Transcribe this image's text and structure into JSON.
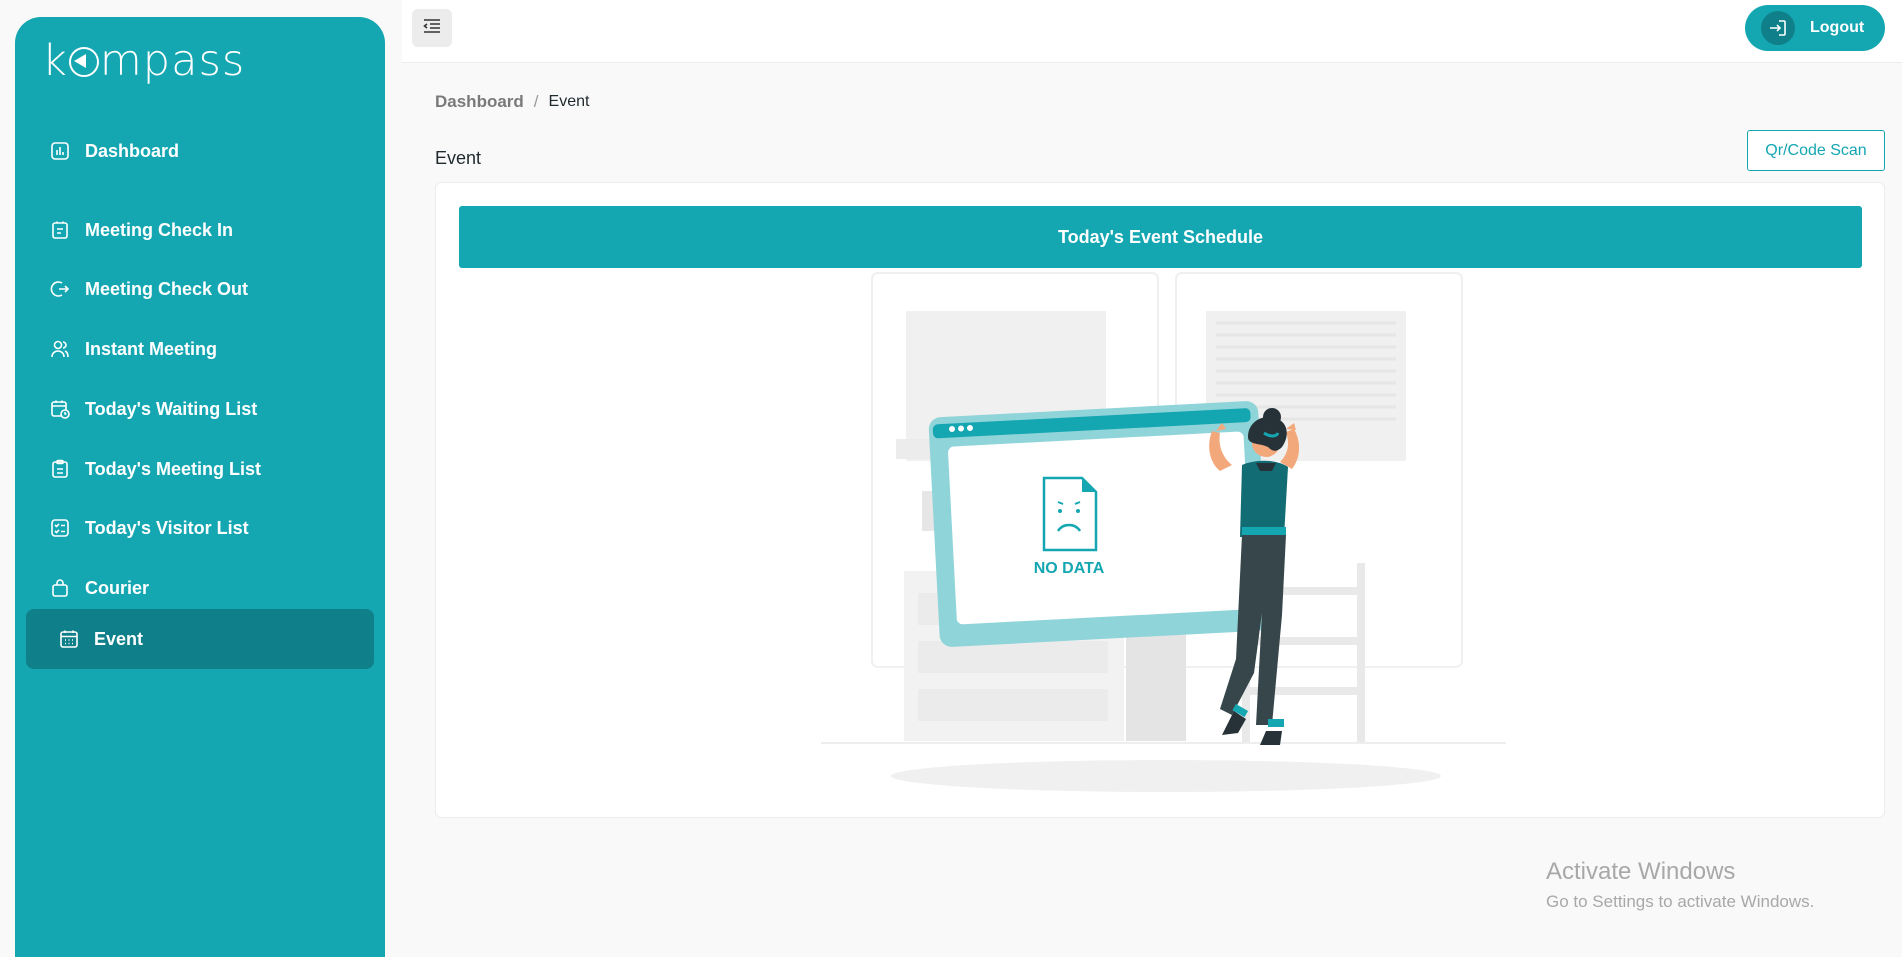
{
  "app": {
    "logo_text": "kompass"
  },
  "sidebar": {
    "items": [
      {
        "label": "Dashboard",
        "icon": "chart-icon"
      },
      {
        "label": "Meeting Check In",
        "icon": "clipboard-icon"
      },
      {
        "label": "Meeting Check Out",
        "icon": "exit-arrow-icon"
      },
      {
        "label": "Instant Meeting",
        "icon": "users-icon"
      },
      {
        "label": "Today's Waiting List",
        "icon": "calendar-clock-icon"
      },
      {
        "label": "Today's Meeting List",
        "icon": "clipboard-list-icon"
      },
      {
        "label": "Today's Visitor List",
        "icon": "checklist-icon"
      },
      {
        "label": "Courier",
        "icon": "bag-icon"
      },
      {
        "label": "Event",
        "icon": "calendar-icon",
        "active": true
      }
    ]
  },
  "topbar": {
    "logout_label": "Logout"
  },
  "breadcrumb": {
    "parent": "Dashboard",
    "separator": "/",
    "current": "Event"
  },
  "page": {
    "title": "Event",
    "qr_button": "Qr/Code Scan",
    "banner": "Today's Event Schedule",
    "empty_state": "NO DATA"
  },
  "watermark": {
    "title": "Activate Windows",
    "subtitle": "Go to Settings to activate Windows."
  },
  "colors": {
    "primary": "#14a6b1",
    "primary_dark": "#0f8089",
    "background": "#f9f9f9"
  }
}
